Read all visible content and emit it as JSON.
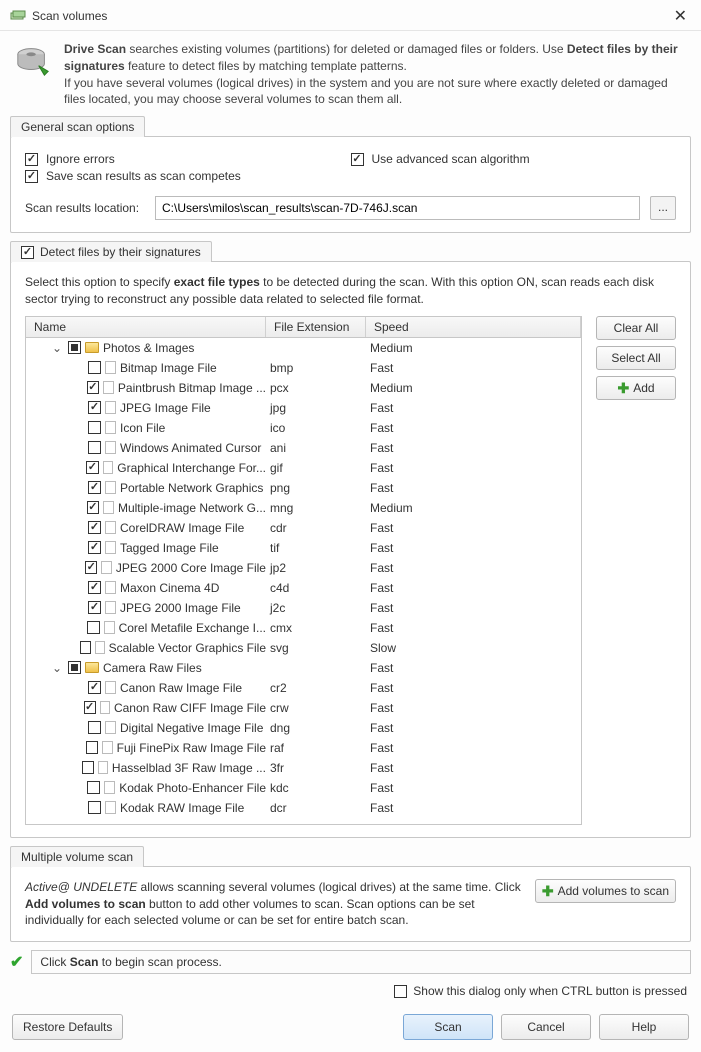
{
  "window": {
    "title": "Scan volumes"
  },
  "header": {
    "line1_a": "Drive Scan",
    "line1_b": " searches existing volumes (partitions) for deleted or damaged files or folders. Use ",
    "line1_c": "Detect files by their signatures",
    "line1_d": " feature to detect files by matching template patterns.",
    "line2": "If you have several volumes (logical drives) in the system and you are not sure where exactly deleted or damaged files located, you may choose several volumes to scan them all."
  },
  "general": {
    "tab": "General scan options",
    "ignore_errors": "Ignore errors",
    "save_results": "Save scan results as scan competes",
    "use_advanced": "Use advanced scan algorithm",
    "location_label": "Scan results location:",
    "location_value": "C:\\Users\\milos\\scan_results\\scan-7D-746J.scan",
    "browse": "..."
  },
  "signatures": {
    "tab": "Detect files by their signatures",
    "desc_a": "Select this option to specify ",
    "desc_b": "exact file types",
    "desc_c": " to be detected during the scan. With this option ON, scan reads each disk sector trying to reconstruct any possible data related to selected file format.",
    "columns": {
      "name": "Name",
      "ext": "File Extension",
      "speed": "Speed"
    },
    "buttons": {
      "clear": "Clear All",
      "select": "Select All",
      "add": "Add"
    },
    "groups": [
      {
        "name": "Photos & Images",
        "speed": "Medium",
        "expanded": true,
        "items": [
          {
            "name": "Bitmap Image File",
            "ext": "bmp",
            "speed": "Fast",
            "checked": false
          },
          {
            "name": "Paintbrush Bitmap Image ...",
            "ext": "pcx",
            "speed": "Medium",
            "checked": true
          },
          {
            "name": "JPEG Image File",
            "ext": "jpg",
            "speed": "Fast",
            "checked": true
          },
          {
            "name": "Icon File",
            "ext": "ico",
            "speed": "Fast",
            "checked": false
          },
          {
            "name": "Windows Animated Cursor",
            "ext": "ani",
            "speed": "Fast",
            "checked": false
          },
          {
            "name": "Graphical Interchange For...",
            "ext": "gif",
            "speed": "Fast",
            "checked": true
          },
          {
            "name": "Portable Network Graphics",
            "ext": "png",
            "speed": "Fast",
            "checked": true
          },
          {
            "name": "Multiple-image Network G...",
            "ext": "mng",
            "speed": "Medium",
            "checked": true
          },
          {
            "name": "CorelDRAW Image File",
            "ext": "cdr",
            "speed": "Fast",
            "checked": true
          },
          {
            "name": "Tagged Image File",
            "ext": "tif",
            "speed": "Fast",
            "checked": true
          },
          {
            "name": "JPEG 2000 Core Image File",
            "ext": "jp2",
            "speed": "Fast",
            "checked": true
          },
          {
            "name": "Maxon Cinema 4D",
            "ext": "c4d",
            "speed": "Fast",
            "checked": true
          },
          {
            "name": "JPEG 2000 Image File",
            "ext": "j2c",
            "speed": "Fast",
            "checked": true
          },
          {
            "name": "Corel Metafile Exchange I...",
            "ext": "cmx",
            "speed": "Fast",
            "checked": false
          },
          {
            "name": "Scalable Vector Graphics File",
            "ext": "svg",
            "speed": "Slow",
            "checked": false
          }
        ]
      },
      {
        "name": "Camera Raw Files",
        "speed": "Fast",
        "expanded": true,
        "items": [
          {
            "name": "Canon Raw Image File",
            "ext": "cr2",
            "speed": "Fast",
            "checked": true
          },
          {
            "name": "Canon Raw CIFF Image File",
            "ext": "crw",
            "speed": "Fast",
            "checked": true
          },
          {
            "name": "Digital Negative Image File",
            "ext": "dng",
            "speed": "Fast",
            "checked": false
          },
          {
            "name": "Fuji FinePix Raw Image File",
            "ext": "raf",
            "speed": "Fast",
            "checked": false
          },
          {
            "name": "Hasselblad 3F Raw Image ...",
            "ext": "3fr",
            "speed": "Fast",
            "checked": false
          },
          {
            "name": "Kodak Photo-Enhancer File",
            "ext": "kdc",
            "speed": "Fast",
            "checked": false
          },
          {
            "name": "Kodak RAW Image File",
            "ext": "dcr",
            "speed": "Fast",
            "checked": false
          }
        ]
      }
    ]
  },
  "multiple": {
    "tab": "Multiple volume scan",
    "text_a": "Active@ UNDELETE",
    "text_b": " allows scanning several volumes (logical drives) at the same time. Click ",
    "text_c": "Add volumes to scan",
    "text_d": " button to add other volumes to scan. Scan options can be set individually for each selected volume or can be set for entire batch scan.",
    "add_button": "Add volumes to scan"
  },
  "hint": {
    "text_a": "Click ",
    "text_b": "Scan",
    "text_c": " to begin scan process."
  },
  "ctrl_option": "Show this dialog only when CTRL button is pressed",
  "footer": {
    "restore": "Restore Defaults",
    "scan": "Scan",
    "cancel": "Cancel",
    "help": "Help"
  }
}
